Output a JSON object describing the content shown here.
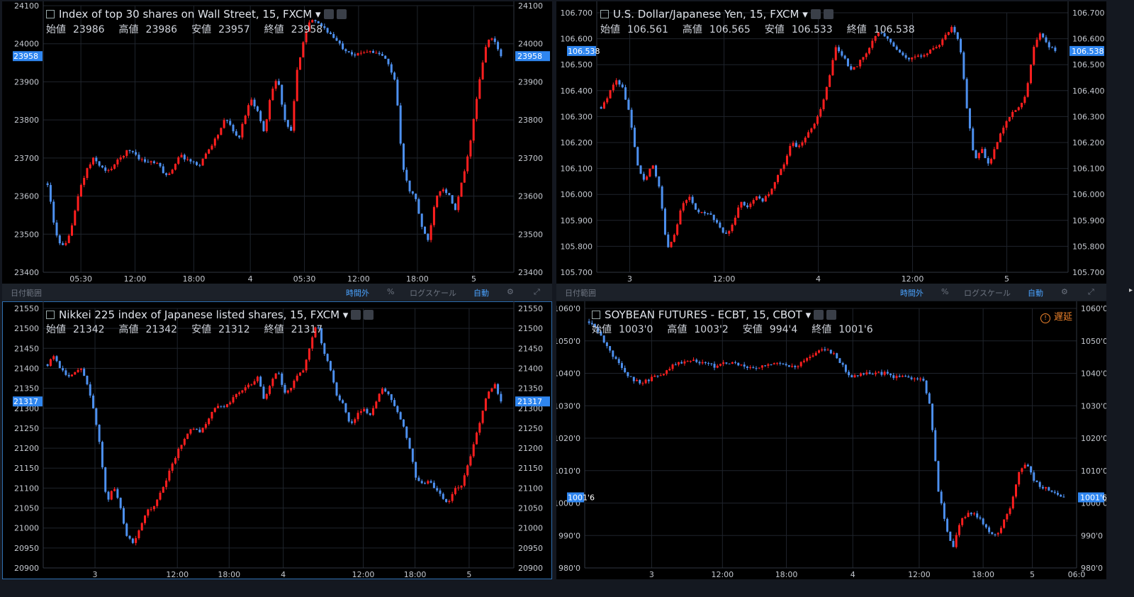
{
  "colors": {
    "up": "#ff1f1f",
    "down": "#4d90ef",
    "grid": "#1f242c",
    "axis_text": "#c5c9d0",
    "badge_bg": "#2f86f0",
    "badge_text": "#ffffff",
    "border": "#303640"
  },
  "toolbar": {
    "date_range": "日付範囲",
    "extended_hours": "時間外",
    "percent": "%",
    "log_scale": "ログスケール",
    "auto": "自動",
    "gear_icon": "gear-icon",
    "fullscreen_icon": "fullscreen-icon"
  },
  "panels": [
    {
      "id": "dow",
      "title": "Index of top 30 shares on Wall Street, 15, FXCM",
      "ohlc": {
        "open_label": "始値",
        "open": "23986",
        "high_label": "高値",
        "high": "23986",
        "low_label": "安値",
        "low": "23957",
        "close_label": "終値",
        "close": "23958"
      },
      "price_label": "23958",
      "delay": null
    },
    {
      "id": "usdjpy",
      "title": "U.S. Dollar/Japanese Yen, 15, FXCM",
      "ohlc": {
        "open_label": "始値",
        "open": "106.561",
        "high_label": "高値",
        "high": "106.565",
        "low_label": "安値",
        "low": "106.533",
        "close_label": "終値",
        "close": "106.538"
      },
      "price_label": "106.538",
      "delay": null
    },
    {
      "id": "nikkei",
      "title": "Nikkei 225 index of Japanese listed shares, 15, FXCM",
      "ohlc": {
        "open_label": "始値",
        "open": "21342",
        "high_label": "高値",
        "high": "21342",
        "low_label": "安値",
        "low": "21312",
        "close_label": "終値",
        "close": "21317"
      },
      "price_label": "21317",
      "delay": null
    },
    {
      "id": "soybean",
      "title": "SOYBEAN FUTURES - ECBT, 15, CBOT",
      "ohlc": {
        "open_label": "始値",
        "open": "1003'0",
        "high_label": "高値",
        "high": "1003'2",
        "low_label": "安値",
        "low": "994'4",
        "close_label": "終値",
        "close": "1001'6"
      },
      "price_label": "1001'6",
      "delay": "遅延"
    }
  ],
  "chart_data": [
    {
      "type": "candlestick",
      "title": "Index of top 30 shares on Wall Street, 15, FXCM",
      "ylim": [
        23350,
        24100
      ],
      "y_ticks": [
        "24100",
        "24000",
        "23900",
        "23800",
        "23700",
        "23600",
        "23500",
        "23400"
      ],
      "x_ticks": [
        "05:30",
        "12:00",
        "18:00",
        "4",
        "05:30",
        "12:00",
        "18:00",
        "5"
      ],
      "close_path": [
        23600,
        23480,
        23420,
        23430,
        23510,
        23590,
        23640,
        23670,
        23650,
        23630,
        23650,
        23670,
        23690,
        23690,
        23670,
        23660,
        23660,
        23650,
        23620,
        23640,
        23680,
        23670,
        23660,
        23650,
        23680,
        23710,
        23740,
        23780,
        23760,
        23720,
        23790,
        23840,
        23800,
        23740,
        23860,
        23900,
        23780,
        23740,
        23920,
        24010,
        24060,
        24050,
        24040,
        24020,
        24000,
        23980,
        23970,
        23960,
        23970,
        23975,
        23965,
        23960,
        23930,
        23880,
        23650,
        23580,
        23560,
        23470,
        23440,
        23560,
        23590,
        23570,
        23520,
        23600,
        23680,
        23800,
        23920,
        24010,
        24000,
        23958
      ],
      "last": 23958
    },
    {
      "type": "candlestick",
      "title": "U.S. Dollar/Japanese Yen, 15, FXCM",
      "ylim": [
        105.6,
        106.7
      ],
      "y_ticks": [
        "106.700",
        "106.600",
        "106.500",
        "106.400",
        "106.300",
        "106.200",
        "106.100",
        "106.000",
        "105.900",
        "105.800",
        "105.700"
      ],
      "x_ticks": [
        "3",
        "12:00",
        "4",
        "12:00",
        "5"
      ],
      "close_path": [
        106.3,
        106.35,
        106.42,
        106.38,
        106.25,
        106.05,
        105.98,
        106.06,
        105.95,
        105.7,
        105.76,
        105.88,
        105.92,
        105.86,
        105.85,
        105.84,
        105.8,
        105.76,
        105.8,
        105.9,
        105.88,
        105.92,
        105.9,
        105.94,
        106.0,
        106.06,
        106.15,
        106.13,
        106.18,
        106.22,
        106.3,
        106.4,
        106.55,
        106.52,
        106.45,
        106.48,
        106.52,
        106.58,
        106.62,
        106.6,
        106.56,
        106.52,
        106.5,
        106.51,
        106.52,
        106.54,
        106.56,
        106.6,
        106.64,
        106.56,
        106.28,
        106.07,
        106.12,
        106.05,
        106.15,
        106.22,
        106.27,
        106.3,
        106.35,
        106.55,
        106.62,
        106.56,
        106.538
      ],
      "last": 106.538
    },
    {
      "type": "candlestick",
      "title": "Nikkei 225 index of Japanese listed shares, 15, FXCM",
      "ylim": [
        20900,
        21550
      ],
      "y_ticks": [
        "21550",
        "21500",
        "21450",
        "21400",
        "21350",
        "21300",
        "21250",
        "21200",
        "21150",
        "21100",
        "21050",
        "21000",
        "20950",
        "20900"
      ],
      "x_ticks": [
        "3",
        "12:00",
        "18:00",
        "4",
        "12:00",
        "18:00",
        "5"
      ],
      "close_path": [
        21410,
        21430,
        21400,
        21380,
        21390,
        21400,
        21360,
        21300,
        21200,
        21060,
        21110,
        21060,
        20980,
        20960,
        21000,
        21040,
        21050,
        21080,
        21120,
        21160,
        21200,
        21230,
        21250,
        21240,
        21260,
        21290,
        21310,
        21300,
        21320,
        21340,
        21350,
        21360,
        21380,
        21320,
        21360,
        21400,
        21340,
        21350,
        21380,
        21400,
        21460,
        21520,
        21440,
        21400,
        21330,
        21310,
        21260,
        21280,
        21300,
        21280,
        21320,
        21350,
        21330,
        21300,
        21260,
        21210,
        21130,
        21110,
        21120,
        21100,
        21080,
        21060,
        21100,
        21110,
        21160,
        21220,
        21280,
        21340,
        21360,
        21317
      ],
      "last": 21317
    },
    {
      "type": "candlestick",
      "title": "SOYBEAN FUTURES - ECBT, 15, CBOT",
      "ylim": [
        980,
        1060
      ],
      "y_ticks": [
        "1060'0",
        "1050'0",
        "1040'0",
        "1030'0",
        "1020'0",
        "1010'0",
        "1000'0",
        "990'0",
        "980'0"
      ],
      "x_ticks": [
        "3",
        "12:00",
        "18:00",
        "4",
        "12:00",
        "18:00",
        "5",
        "06:0"
      ],
      "close_path": [
        1056,
        1054,
        1050,
        1046,
        1043,
        1040,
        1038,
        1037,
        1038,
        1039,
        1040,
        1042,
        1043,
        1044,
        1044,
        1043,
        1043,
        1042,
        1043,
        1043,
        1043,
        1042,
        1042,
        1042,
        1043,
        1043,
        1043,
        1042,
        1042,
        1044,
        1045,
        1047,
        1047,
        1046,
        1043,
        1039,
        1039,
        1040,
        1040,
        1040,
        1040,
        1039,
        1039,
        1039,
        1038,
        1038,
        1030,
        1005,
        994,
        986,
        994,
        997,
        997,
        994,
        991,
        990,
        995,
        1000,
        1010,
        1012,
        1007,
        1005,
        1004,
        1003,
        1001.75
      ],
      "last": 1001.75
    }
  ]
}
